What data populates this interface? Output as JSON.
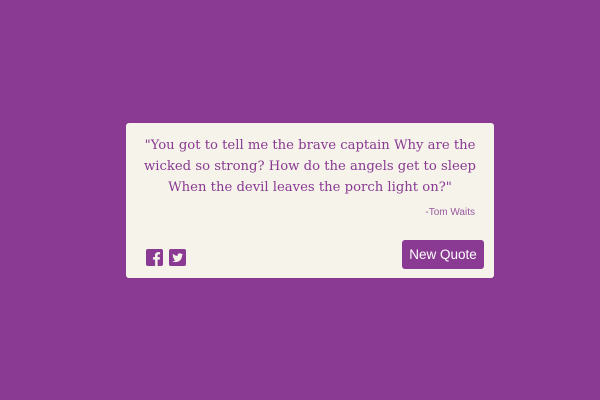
{
  "quote": {
    "text": "\"You got to tell me the brave captain Why are the wicked so strong? How do the angels get to sleep When the devil leaves the porch light on?\"",
    "author": "-Tom Waits"
  },
  "actions": {
    "new_quote_label": "New Quote"
  },
  "social": [
    {
      "icon": "facebook-icon"
    },
    {
      "icon": "twitter-icon"
    }
  ],
  "colors": {
    "background": "#8a3a92",
    "card": "#f5f3ea",
    "accent": "#8a3a92"
  }
}
